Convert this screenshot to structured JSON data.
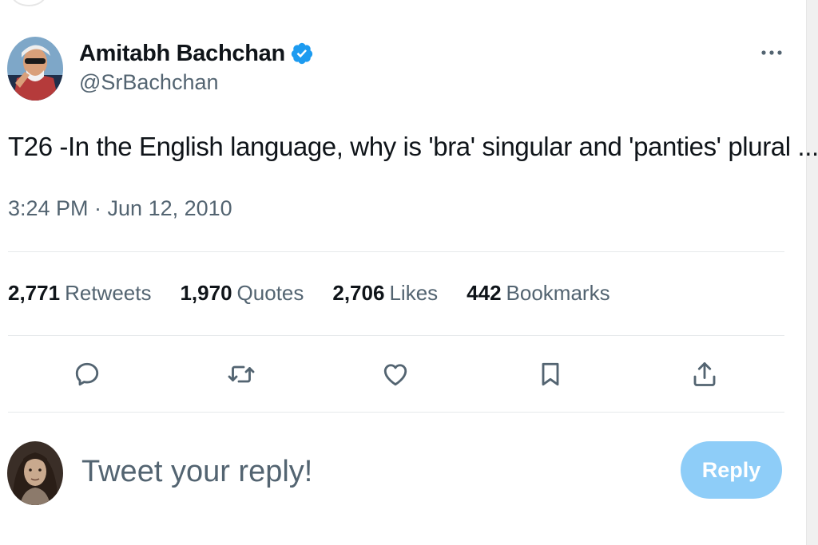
{
  "author": {
    "display_name": "Amitabh Bachchan",
    "handle": "@SrBachchan",
    "verified_icon": "verified-badge-icon",
    "avatar": "profile-photo"
  },
  "tweet": {
    "text": "T26 -In the English language, why is 'bra' singular and 'panties' plural ...",
    "timestamp": "3:24 PM · Jun 12, 2010"
  },
  "stats": [
    {
      "count": "2,771",
      "label": "Retweets"
    },
    {
      "count": "1,970",
      "label": "Quotes"
    },
    {
      "count": "2,706",
      "label": "Likes"
    },
    {
      "count": "442",
      "label": "Bookmarks"
    }
  ],
  "actions": [
    {
      "name": "reply",
      "icon": "comment-icon"
    },
    {
      "name": "retweet",
      "icon": "retweet-icon"
    },
    {
      "name": "like",
      "icon": "heart-icon"
    },
    {
      "name": "bookmark",
      "icon": "bookmark-icon"
    },
    {
      "name": "share",
      "icon": "share-icon"
    }
  ],
  "composer": {
    "placeholder": "Tweet your reply!",
    "button_label": "Reply"
  },
  "colors": {
    "text_primary": "#0f1419",
    "text_secondary": "#536471",
    "verified_blue": "#1d9bf0",
    "reply_button_disabled": "#8ecdf8",
    "divider": "#e6e9eb"
  }
}
